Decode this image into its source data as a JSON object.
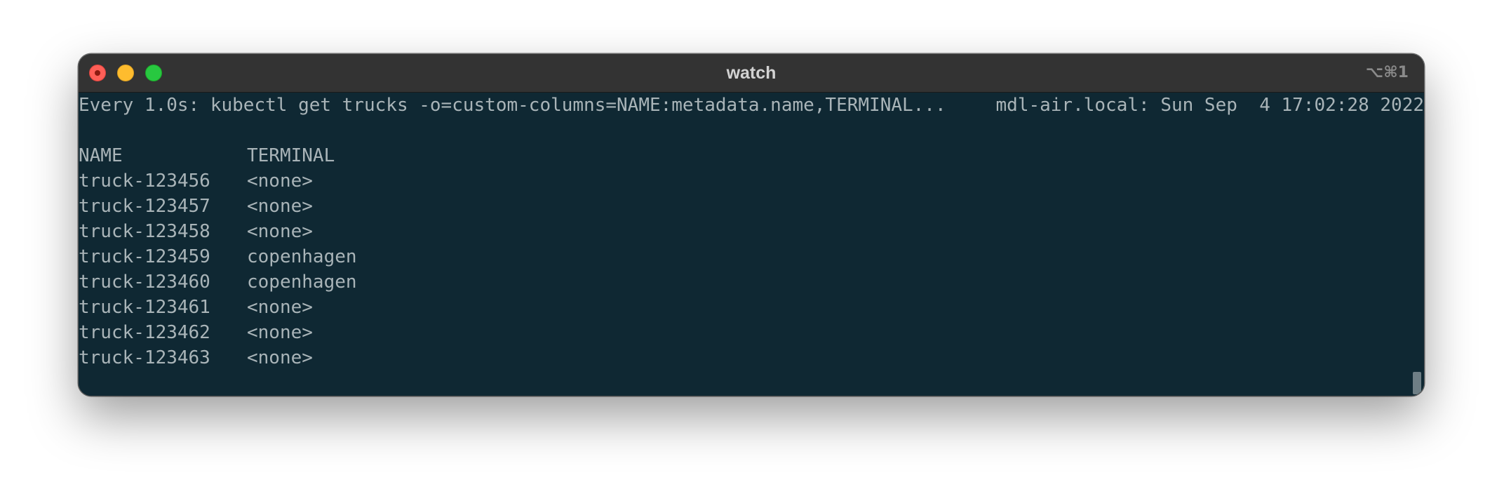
{
  "window": {
    "title": "watch",
    "shortcut": "⌥⌘1"
  },
  "terminal": {
    "header_command": "Every 1.0s: kubectl get trucks -o=custom-columns=NAME:metadata.name,TERMINAL...",
    "header_host_time": "mdl-air.local: Sun Sep  4 17:02:28 2022",
    "columns": [
      "NAME",
      "TERMINAL"
    ],
    "rows": [
      {
        "name": "truck-123456",
        "terminal": "<none>"
      },
      {
        "name": "truck-123457",
        "terminal": "<none>"
      },
      {
        "name": "truck-123458",
        "terminal": "<none>"
      },
      {
        "name": "truck-123459",
        "terminal": "copenhagen"
      },
      {
        "name": "truck-123460",
        "terminal": "copenhagen"
      },
      {
        "name": "truck-123461",
        "terminal": "<none>"
      },
      {
        "name": "truck-123462",
        "terminal": "<none>"
      },
      {
        "name": "truck-123463",
        "terminal": "<none>"
      }
    ]
  }
}
